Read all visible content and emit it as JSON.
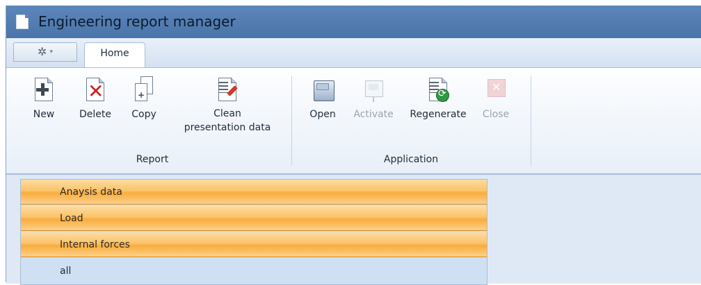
{
  "window": {
    "title": "Engineering report manager"
  },
  "tabs": [
    {
      "label": "Home"
    }
  ],
  "ribbon": {
    "groups": [
      {
        "label": "Report",
        "buttons": [
          {
            "label": "New",
            "icon": "new-document-icon",
            "enabled": true
          },
          {
            "label": "Delete",
            "icon": "delete-document-icon",
            "enabled": true
          },
          {
            "label": "Copy",
            "icon": "copy-document-icon",
            "enabled": true
          },
          {
            "label_line1": "Clean",
            "label_line2": "presentation data",
            "icon": "clean-data-icon",
            "enabled": true
          }
        ]
      },
      {
        "label": "Application",
        "buttons": [
          {
            "label": "Open",
            "icon": "open-folder-icon",
            "enabled": true
          },
          {
            "label": "Activate",
            "icon": "activate-icon",
            "enabled": false
          },
          {
            "label": "Regenerate",
            "icon": "regenerate-icon",
            "enabled": true
          },
          {
            "label": "Close",
            "icon": "close-icon",
            "enabled": false
          }
        ]
      }
    ]
  },
  "panel": {
    "headers": [
      {
        "label": "Anaysis data"
      },
      {
        "label": "Load"
      },
      {
        "label": "Internal forces"
      }
    ],
    "items": [
      {
        "label": "all"
      }
    ]
  },
  "colors": {
    "title_bar": "#5d86b9",
    "header_orange": "#f9ad3c",
    "panel_blue": "#cfe0f2"
  }
}
